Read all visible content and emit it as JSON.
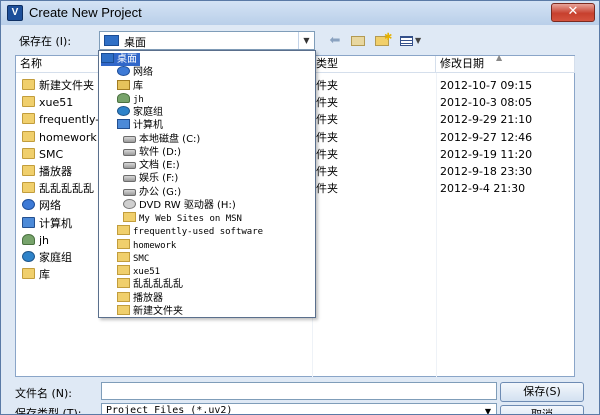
{
  "window": {
    "app_icon": "V",
    "title": "Create New Project",
    "close_symbol": "✕"
  },
  "toolbar": {
    "save_in_label": "保存在 (I):",
    "location_value": "桌面",
    "combo_arrow": "▼",
    "back_icon": "back-arrow-icon",
    "back_symbol": "⬅",
    "up_icon": "up-folder-icon",
    "new_folder_icon": "new-folder-icon",
    "new_folder_star": "✱",
    "view_menu_icon": "view-menu-icon",
    "view_arrow": "▼"
  },
  "columns": {
    "name": "名称",
    "type": "类型",
    "date": "修改日期",
    "sort_caret": "▲"
  },
  "files": [
    {
      "name": "新建文件夹",
      "icon": "folder",
      "type": "件夹",
      "date": "2012-10-7 09:15"
    },
    {
      "name": "xue51",
      "icon": "folder",
      "type": "件夹",
      "date": "2012-10-3 08:05"
    },
    {
      "name": "frequently-used software",
      "icon": "folder",
      "type": "件夹",
      "date": "2012-9-29 21:10"
    },
    {
      "name": "homework",
      "icon": "folder",
      "type": "件夹",
      "date": "2012-9-27 12:46"
    },
    {
      "name": "SMC",
      "icon": "folder",
      "type": "件夹",
      "date": "2012-9-19 11:20"
    },
    {
      "name": "播放器",
      "icon": "folder",
      "type": "件夹",
      "date": "2012-9-18 23:30"
    },
    {
      "name": "乱乱乱乱乱",
      "icon": "folder",
      "type": "件夹",
      "date": "2012-9-4 21:30"
    },
    {
      "name": "网络",
      "icon": "net",
      "type": "",
      "date": ""
    },
    {
      "name": "计算机",
      "icon": "pc",
      "type": "",
      "date": ""
    },
    {
      "name": "jh",
      "icon": "user",
      "type": "",
      "date": ""
    },
    {
      "name": "家庭组",
      "icon": "home",
      "type": "",
      "date": ""
    },
    {
      "name": "库",
      "icon": "folder",
      "type": "",
      "date": ""
    }
  ],
  "dropdown": [
    {
      "label": "桌面",
      "icon": "desk",
      "level": 0,
      "selected": true
    },
    {
      "label": "网络",
      "icon": "net",
      "level": 1
    },
    {
      "label": "库",
      "icon": "lib",
      "level": 1
    },
    {
      "label": "jh",
      "icon": "user",
      "level": 1
    },
    {
      "label": "家庭组",
      "icon": "home",
      "level": 1
    },
    {
      "label": "计算机",
      "icon": "pc",
      "level": 1
    },
    {
      "label": "本地磁盘 (C:)",
      "icon": "drive",
      "level": 2
    },
    {
      "label": "软件 (D:)",
      "icon": "drive",
      "level": 2
    },
    {
      "label": "文档 (E:)",
      "icon": "drive",
      "level": 2
    },
    {
      "label": "娱乐 (F:)",
      "icon": "drive",
      "level": 2
    },
    {
      "label": "办公 (G:)",
      "icon": "drive",
      "level": 2
    },
    {
      "label": "DVD RW 驱动器 (H:)",
      "icon": "dvd",
      "level": 2
    },
    {
      "label": "My Web Sites on MSN",
      "icon": "folder",
      "level": 2
    },
    {
      "label": "frequently-used software",
      "icon": "folder",
      "level": 1
    },
    {
      "label": "homework",
      "icon": "folder",
      "level": 1
    },
    {
      "label": "SMC",
      "icon": "folder",
      "level": 1
    },
    {
      "label": "xue51",
      "icon": "folder",
      "level": 1
    },
    {
      "label": "乱乱乱乱乱",
      "icon": "folder",
      "level": 1
    },
    {
      "label": "播放器",
      "icon": "folder",
      "level": 1
    },
    {
      "label": "新建文件夹",
      "icon": "folder",
      "level": 1
    }
  ],
  "bottom": {
    "filename_label": "文件名 (N):",
    "filename_value": "",
    "save_label": "保存(S)",
    "filetype_label": "保存类型 (T):",
    "filetype_value": "Project Files (*.uv2)",
    "filetype_arrow": "▼",
    "cancel_label": "取消"
  }
}
